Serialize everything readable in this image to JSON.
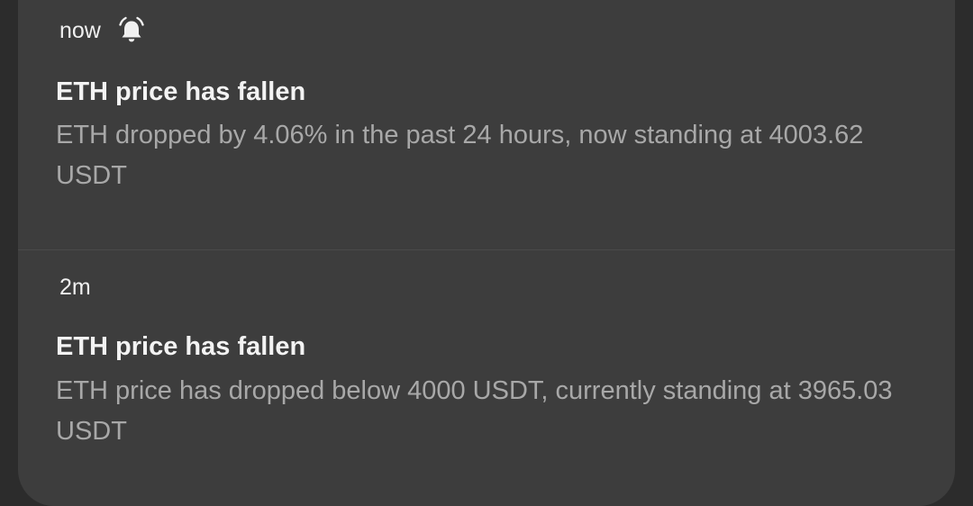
{
  "notifications": [
    {
      "time": "now",
      "icon": "alarm-bell-icon",
      "title": "ETH price has fallen",
      "body": "ETH dropped by 4.06% in the past 24 hours, now standing at 4003.62 USDT"
    },
    {
      "time": "2m",
      "title": "ETH price has fallen",
      "body": "ETH price has dropped below 4000 USDT, currently standing at 3965.03 USDT"
    }
  ],
  "colors": {
    "background": "#2c2c2c",
    "panel": "#3d3d3d",
    "title_text": "#f3f3f3",
    "body_text": "#a8a8a8"
  }
}
